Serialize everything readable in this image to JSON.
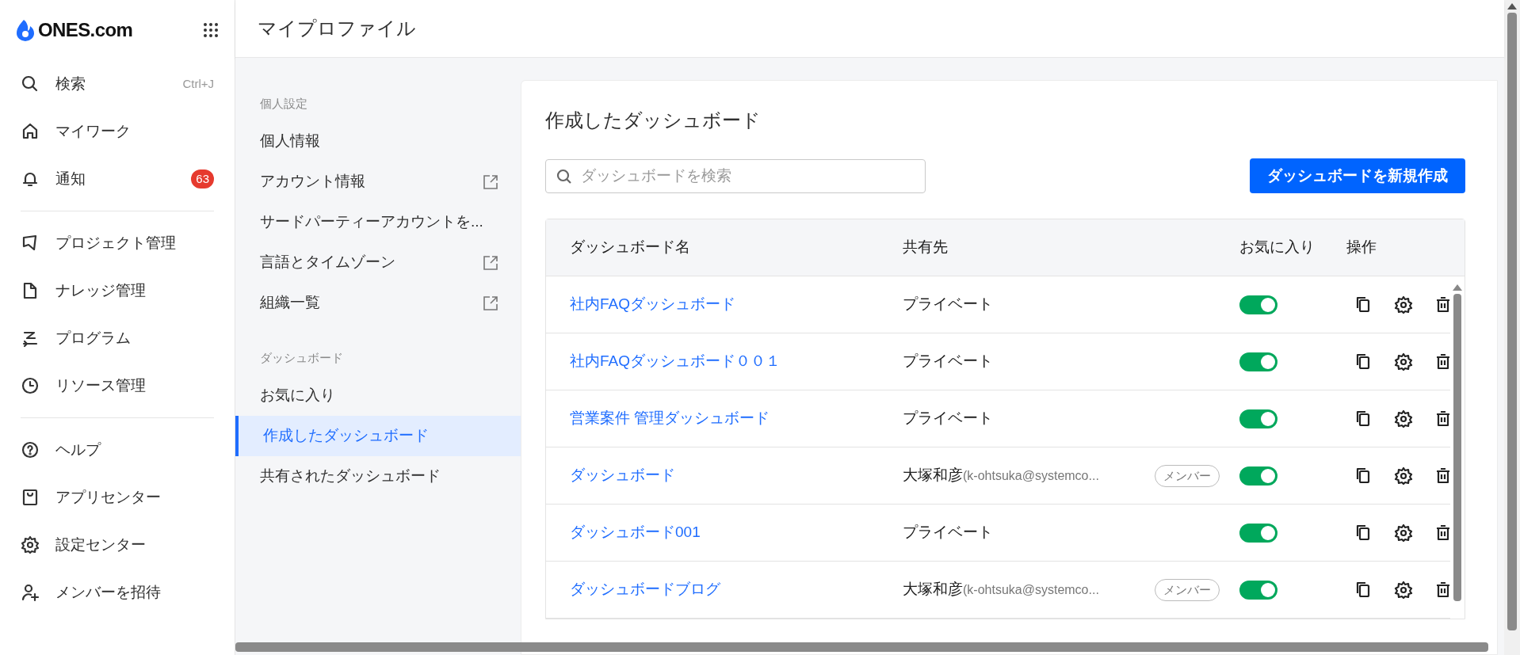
{
  "logo": {
    "text": "ONES.com"
  },
  "sidebar": {
    "groups": [
      [
        {
          "label": "検索",
          "shortcut": "Ctrl+J"
        },
        {
          "label": "マイワーク"
        },
        {
          "label": "通知",
          "badge": "63"
        }
      ],
      [
        {
          "label": "プロジェクト管理"
        },
        {
          "label": "ナレッジ管理"
        },
        {
          "label": "プログラム"
        },
        {
          "label": "リソース管理"
        }
      ],
      [
        {
          "label": "ヘルプ"
        },
        {
          "label": "アプリセンター"
        },
        {
          "label": "設定センター"
        },
        {
          "label": "メンバーを招待"
        }
      ]
    ]
  },
  "header": {
    "title": "マイプロファイル"
  },
  "nav": {
    "sections": [
      {
        "heading": "個人設定",
        "items": [
          {
            "label": "個人情報",
            "external": false,
            "selected": false
          },
          {
            "label": "アカウント情報",
            "external": true,
            "selected": false
          },
          {
            "label": "サードパーティーアカウントを...",
            "external": false,
            "selected": false
          },
          {
            "label": "言語とタイムゾーン",
            "external": true,
            "selected": false
          },
          {
            "label": "組織一覧",
            "external": true,
            "selected": false
          }
        ]
      },
      {
        "heading": "ダッシュボード",
        "items": [
          {
            "label": "お気に入り",
            "external": false,
            "selected": false
          },
          {
            "label": "作成したダッシュボード",
            "external": false,
            "selected": true
          },
          {
            "label": "共有されたダッシュボード",
            "external": false,
            "selected": false
          }
        ]
      }
    ]
  },
  "panel": {
    "title": "作成したダッシュボード",
    "search": {
      "placeholder": "ダッシュボードを検索"
    },
    "create_button": "ダッシュボードを新規作成",
    "table": {
      "columns": [
        "ダッシュボード名",
        "共有先",
        "お気に入り",
        "操作"
      ],
      "rows": [
        {
          "name": "社内FAQダッシュボード",
          "share": "プライベート",
          "favorite": true
        },
        {
          "name": "社内FAQダッシュボード００１",
          "share": "プライベート",
          "favorite": true
        },
        {
          "name": "営業案件 管理ダッシュボード",
          "share": "プライベート",
          "favorite": true
        },
        {
          "name": "ダッシュボード",
          "share": "大塚和彦",
          "share_email": "(k-ohtsuka@systemco...",
          "role": "メンバー",
          "favorite": true
        },
        {
          "name": "ダッシュボード001",
          "share": "プライベート",
          "favorite": true
        },
        {
          "name": "ダッシュボードブログ",
          "share": "大塚和彦",
          "share_email": "(k-ohtsuka@systemco...",
          "role": "メンバー",
          "favorite": true
        }
      ]
    }
  }
}
